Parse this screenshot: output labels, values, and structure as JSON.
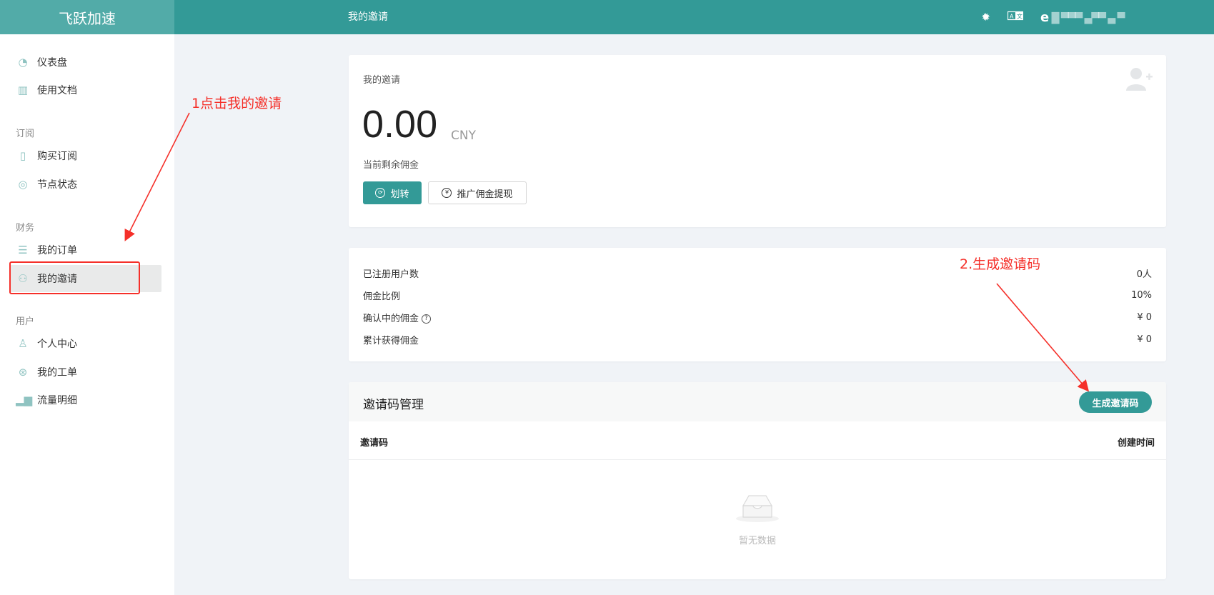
{
  "app": {
    "brand": "飞跃加速",
    "page_title": "我的邀请"
  },
  "header": {
    "theme_icon": "sun-icon",
    "lang_icon": "translate-icon",
    "user_initial": "e",
    "user_email": "█ ▀▀▀ ▄▀▀ ▄ ▀"
  },
  "sidebar": {
    "items": [
      {
        "label": "仪表盘",
        "icon": "dashboard-icon"
      },
      {
        "label": "使用文档",
        "icon": "book-icon"
      },
      {
        "label": "购买订阅",
        "icon": "clipboard-icon"
      },
      {
        "label": "节点状态",
        "icon": "check-circle-icon"
      },
      {
        "label": "我的订单",
        "icon": "list-icon"
      },
      {
        "label": "我的邀请",
        "icon": "user-share-icon"
      },
      {
        "label": "个人中心",
        "icon": "user-icon"
      },
      {
        "label": "我的工单",
        "icon": "lifebuoy-icon"
      },
      {
        "label": "流量明细",
        "icon": "bar-chart-icon"
      }
    ],
    "groups": [
      "订阅",
      "财务",
      "用户"
    ],
    "active_item": "我的邀请"
  },
  "invite_card": {
    "label": "我的邀请",
    "balance": "0.00",
    "currency": "CNY",
    "balance_caption": "当前剩余佣金",
    "transfer_button": "划转",
    "withdraw_button": "推广佣金提现"
  },
  "stats": [
    {
      "label": "已注册用户数",
      "value": "0人"
    },
    {
      "label": "佣金比例",
      "value": "10%"
    },
    {
      "label": "确认中的佣金",
      "value": "¥ 0"
    },
    {
      "label": "累计获得佣金",
      "value": "¥ 0"
    }
  ],
  "invite_codes": {
    "title": "邀请码管理",
    "generate_button": "生成邀请码",
    "columns": [
      "邀请码",
      "创建时间"
    ],
    "empty_text": "暂无数据"
  },
  "annotations": {
    "step1": "1点击我的邀请",
    "step2": "2.生成邀请码",
    "color": "#f5302a"
  },
  "colors": {
    "primary": "#339a97",
    "brand_bg": "#52aba8",
    "page_bg": "#f0f3f7"
  }
}
